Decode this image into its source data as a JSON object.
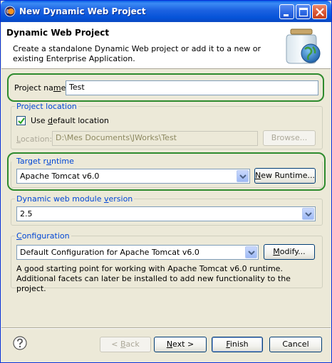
{
  "window": {
    "title": "New Dynamic Web Project",
    "controls": {
      "minimize": "minimize",
      "maximize": "maximize",
      "close": "close"
    }
  },
  "header": {
    "title": "Dynamic Web Project",
    "description": "Create a standalone Dynamic Web project or add it to a new or existing Enterprise Application."
  },
  "project_name": {
    "label_pre": "Project na",
    "label_mnemonic": "m",
    "label_post": "e:",
    "value": "Test"
  },
  "project_location": {
    "group_label": "Project location",
    "use_default_pre": "Use ",
    "use_default_mnemonic": "d",
    "use_default_post": "efault location",
    "use_default_checked": true,
    "location_mnemonic": "L",
    "location_post": "ocation:",
    "location_value": "D:\\Mes Documents\\JWorks\\Test",
    "browse_label": "Browse..."
  },
  "target_runtime": {
    "group_pre": "Target r",
    "group_mnemonic": "u",
    "group_post": "ntime",
    "selected": "Apache Tomcat v6.0",
    "new_runtime_mnemonic": "N",
    "new_runtime_post": "ew Runtime..."
  },
  "module_version": {
    "group_label_pre": "Dynamic web module ",
    "group_label_mnemonic": "v",
    "group_label_post": "ersion",
    "selected": "2.5"
  },
  "configuration": {
    "group_mnemonic": "C",
    "group_post": "onfiguration",
    "selected": "Default Configuration for Apache Tomcat v6.0",
    "modify_mnemonic": "M",
    "modify_post": "odify...",
    "description": "A good starting point for working with Apache Tomcat v6.0 runtime. Additional facets can later be installed to add new functionality to the project."
  },
  "footer": {
    "back_pre": "< ",
    "back_mnemonic": "B",
    "back_post": "ack",
    "next_mnemonic": "N",
    "next_post": "ext >",
    "finish_mnemonic": "F",
    "finish_post": "inish",
    "cancel_label": "Cancel"
  },
  "colors": {
    "title_bar": "#0553D8",
    "highlight": "#2E8B2E",
    "group_label": "#0046D5"
  }
}
